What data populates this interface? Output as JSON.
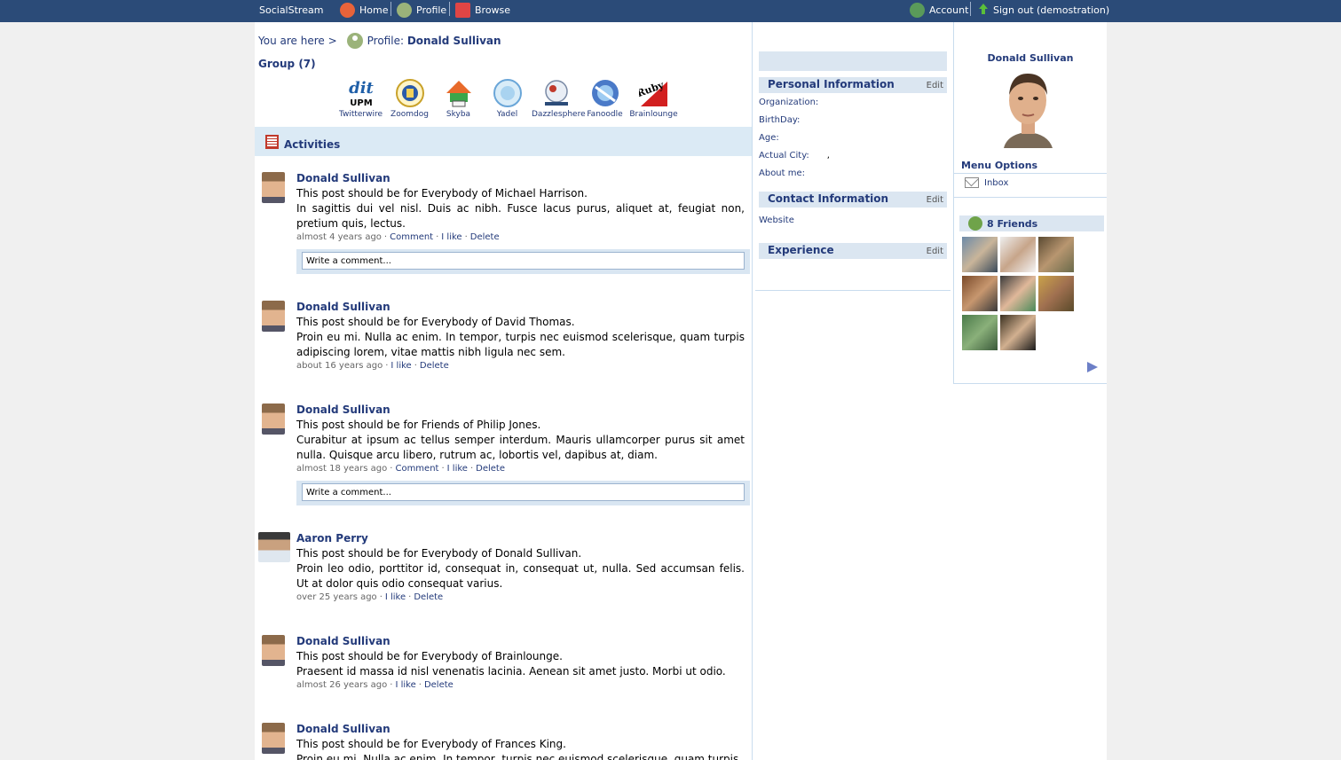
{
  "topbar": {
    "brand": "SocialStream",
    "home": "Home",
    "profile": "Profile",
    "browse": "Browse",
    "account": "Account",
    "signout": "Sign out (demostration)"
  },
  "breadcrumb": {
    "prefix": "You are here >",
    "label": "Profile:",
    "name": "Donald Sullivan"
  },
  "groups": {
    "title": "Group (7)",
    "items": [
      {
        "name": "Twitterwire",
        "logo_text": "dit UPM"
      },
      {
        "name": "Zoomdog",
        "logo_text": ""
      },
      {
        "name": "Skyba",
        "logo_text": ""
      },
      {
        "name": "Yadel",
        "logo_text": ""
      },
      {
        "name": "Dazzlesphere",
        "logo_text": ""
      },
      {
        "name": "Fanoodle",
        "logo_text": ""
      },
      {
        "name": "Brainlounge",
        "logo_text": "Ruby"
      }
    ]
  },
  "activities": {
    "title": "Activities",
    "comment_placeholder": "Write a comment...",
    "posts": [
      {
        "author": "Donald Sullivan",
        "line1": "This post should be for Everybody of Michael Harrison.",
        "line2": "In sagittis dui vel nisl. Duis ac nibh. Fusce lacus purus, aliquet at, feugiat non, pretium quis, lectus.",
        "time": "almost 4 years ago",
        "comment": "Comment",
        "like": "I like",
        "delete": "Delete"
      },
      {
        "author": "Donald Sullivan",
        "line1": "This post should be for Everybody of David Thomas.",
        "line2": "Proin eu mi. Nulla ac enim. In tempor, turpis nec euismod scelerisque, quam turpis adipiscing lorem, vitae mattis nibh ligula nec sem.",
        "time": "about 16 years ago",
        "like": "I like",
        "delete": "Delete"
      },
      {
        "author": "Donald Sullivan",
        "line1": "This post should be for Friends of Philip Jones.",
        "line2": "Curabitur at ipsum ac tellus semper interdum. Mauris ullamcorper purus sit amet nulla. Quisque arcu libero, rutrum ac, lobortis vel, dapibus at, diam.",
        "time": "almost 18 years ago",
        "comment": "Comment",
        "like": "I like",
        "delete": "Delete"
      },
      {
        "author": "Aaron Perry",
        "line1": "This post should be for Everybody of Donald Sullivan.",
        "line2": "Proin leo odio, porttitor id, consequat in, consequat ut, nulla. Sed accumsan felis. Ut at dolor quis odio consequat varius.",
        "time": "over 25 years ago",
        "like": "I like",
        "delete": "Delete"
      },
      {
        "author": "Donald Sullivan",
        "line1": "This post should be for Everybody of Brainlounge.",
        "line2": "Praesent id massa id nisl venenatis lacinia. Aenean sit amet justo. Morbi ut odio.",
        "time": "almost 26 years ago",
        "like": "I like",
        "delete": "Delete"
      },
      {
        "author": "Donald Sullivan",
        "line1": "This post should be for Everybody of Frances King.",
        "line2": "Proin eu mi. Nulla ac enim. In tempor, turpis nec euismod scelerisque, quam turpis"
      }
    ]
  },
  "info": {
    "personal": "Personal Information",
    "edit": "Edit",
    "organization": "Organization:",
    "birthday": "BirthDay:",
    "age": "Age:",
    "city": "Actual City:",
    "city_value": ",",
    "about": "About me:",
    "contact": "Contact Information",
    "website": "Website",
    "experience": "Experience"
  },
  "sidebar": {
    "name": "Donald Sullivan",
    "menu_options": "Menu Options",
    "inbox": "Inbox",
    "friends": "8 Friends"
  },
  "colors": {
    "topbar": "#2b4b78",
    "link": "#233a7a",
    "section_bg": "#dbe6f1"
  }
}
